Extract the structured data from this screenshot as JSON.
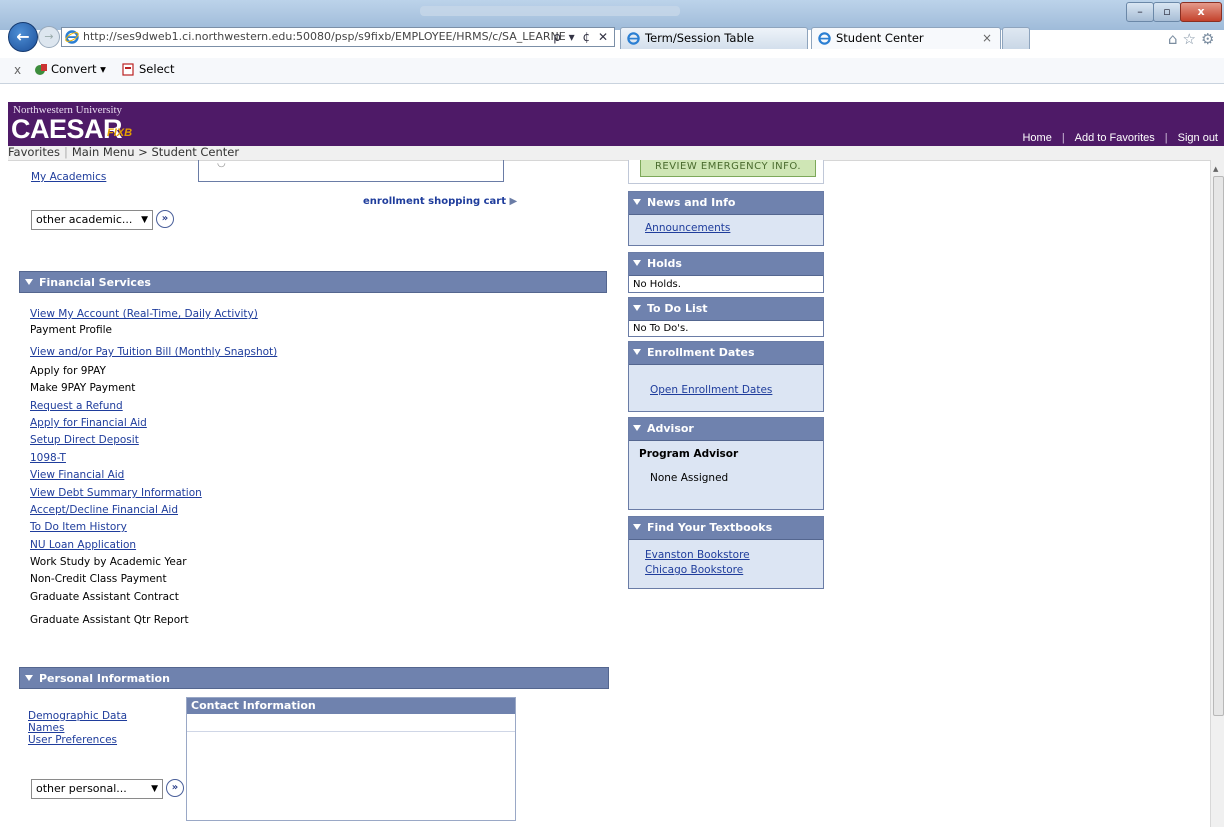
{
  "browser": {
    "url": "http://ses9dweb1.ci.northwestern.edu:50080/psp/s9fixb/EMPLOYEE/HRMS/c/SA_LEARNE",
    "addr_controls": "ρ ▾ ¢ ✕",
    "tabs": [
      {
        "label": "Term/Session Table"
      },
      {
        "label": "Student Center",
        "close": "×"
      }
    ],
    "window_controls": {
      "minimize": "–",
      "maximize": "▫",
      "close": "x"
    },
    "command_bar": {
      "close": "x",
      "convert_label": "Convert ▾",
      "select_label": "Select"
    }
  },
  "header": {
    "university": "Northwestern University",
    "logo": "CAESAR",
    "env": "FIXB",
    "links": [
      "Home",
      "Add to Favorites",
      "Sign out"
    ]
  },
  "breadcrumb": {
    "favorites": "Favorites",
    "main_menu": "Main Menu",
    "arrow": ">",
    "current": "Student Center"
  },
  "academics": {
    "my_academics": "My Academics",
    "select_value": "other academic...",
    "shopping_cart": "enrollment shopping cart"
  },
  "financial": {
    "title": "Financial Services",
    "items": [
      {
        "label": "View My Account (Real-Time, Daily Activity)",
        "link": true
      },
      {
        "label": "Payment Profile",
        "link": false
      },
      {
        "label": "View and/or Pay Tuition Bill (Monthly Snapshot)",
        "link": true
      },
      {
        "label": "Apply for 9PAY",
        "link": false
      },
      {
        "label": "Make 9PAY Payment",
        "link": false
      },
      {
        "label": "Request a Refund",
        "link": true
      },
      {
        "label": "Apply for Financial Aid",
        "link": true
      },
      {
        "label": "Setup Direct Deposit",
        "link": true
      },
      {
        "label": "1098-T",
        "link": true
      },
      {
        "label": "View Financial Aid",
        "link": true
      },
      {
        "label": "View Debt Summary Information",
        "link": true
      },
      {
        "label": "Accept/Decline Financial Aid",
        "link": true
      },
      {
        "label": "To Do Item History",
        "link": true
      },
      {
        "label": "NU Loan Application",
        "link": true
      },
      {
        "label": "Work Study by Academic Year",
        "link": false
      },
      {
        "label": "Non-Credit Class Payment",
        "link": false
      },
      {
        "label": "Graduate Assistant Contract",
        "link": false
      },
      {
        "label": "Graduate Assistant Qtr Report",
        "link": false
      }
    ]
  },
  "personal": {
    "title": "Personal Information",
    "links": [
      "Demographic Data",
      "Names",
      "User Preferences"
    ],
    "select_value": "other personal...",
    "contact_title": "Contact Information"
  },
  "sidebar": {
    "emergency_button": "REVIEW EMERGENCY INFO.",
    "news": {
      "title": "News and Info",
      "link": "Announcements"
    },
    "holds": {
      "title": "Holds",
      "text": "No Holds."
    },
    "todo": {
      "title": "To Do List",
      "text": "No To Do's."
    },
    "enrollment": {
      "title": "Enrollment Dates",
      "link": "Open Enrollment Dates"
    },
    "advisor": {
      "title": "Advisor",
      "label": "Program Advisor",
      "value": "None Assigned"
    },
    "textbooks": {
      "title": "Find Your Textbooks",
      "links": [
        "Evanston Bookstore",
        "Chicago Bookstore"
      ]
    }
  },
  "colors": {
    "header_purple": "#4e1a67",
    "section_blue": "#6f82ae",
    "link_blue": "#1f3d9c",
    "env_orange": "#e4a000"
  }
}
